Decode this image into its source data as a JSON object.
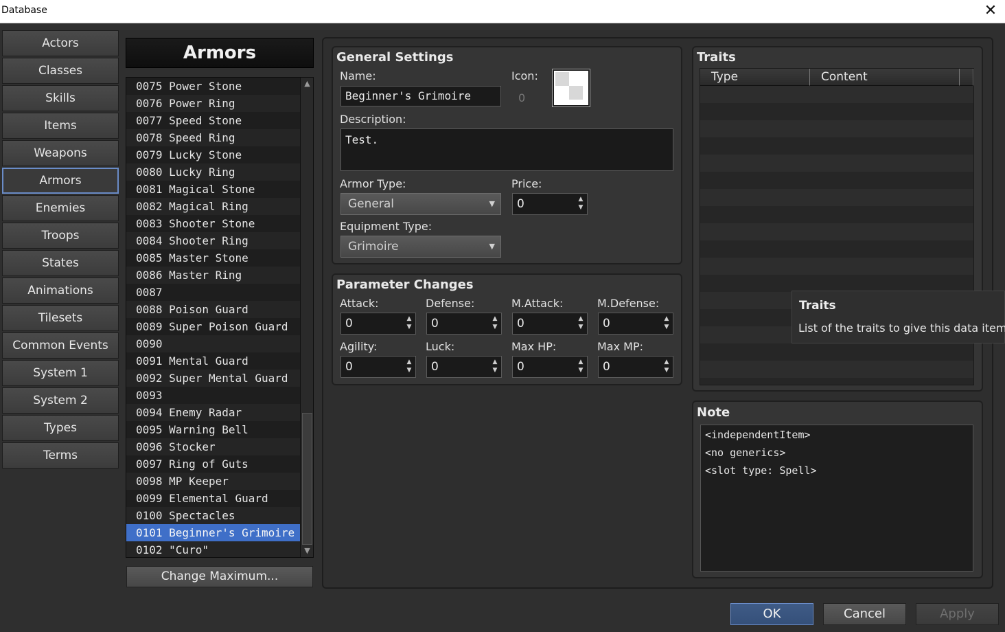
{
  "window": {
    "title": "Database",
    "close_glyph": "✕"
  },
  "nav": [
    "Actors",
    "Classes",
    "Skills",
    "Items",
    "Weapons",
    "Armors",
    "Enemies",
    "Troops",
    "States",
    "Animations",
    "Tilesets",
    "Common Events",
    "System 1",
    "System 2",
    "Types",
    "Terms"
  ],
  "nav_active": "Armors",
  "list": {
    "header": "Armors",
    "items": [
      "0075 Power Stone",
      "0076 Power Ring",
      "0077 Speed Stone",
      "0078 Speed Ring",
      "0079 Lucky Stone",
      "0080 Lucky Ring",
      "0081 Magical Stone",
      "0082 Magical Ring",
      "0083 Shooter Stone",
      "0084 Shooter Ring",
      "0085 Master Stone",
      "0086 Master Ring",
      "0087",
      "0088 Poison Guard",
      "0089 Super Poison Guard",
      "0090",
      "0091 Mental Guard",
      "0092 Super Mental Guard",
      "0093",
      "0094 Enemy Radar",
      "0095 Warning Bell",
      "0096 Stocker",
      "0097 Ring of Guts",
      "0098 MP Keeper",
      "0099 Elemental Guard",
      "0100 Spectacles",
      "0101 Beginner's Grimoire",
      "0102 \"Curo\""
    ],
    "selected": "0101 Beginner's Grimoire",
    "change_max_label": "Change Maximum..."
  },
  "general": {
    "title": "General Settings",
    "name_label": "Name:",
    "name_value": "Beginner's Grimoire",
    "icon_label": "Icon:",
    "icon_index": "0",
    "description_label": "Description:",
    "description_value": "Test.",
    "armor_type_label": "Armor Type:",
    "armor_type_value": "General",
    "price_label": "Price:",
    "price_value": "0",
    "equip_type_label": "Equipment Type:",
    "equip_type_value": "Grimoire"
  },
  "params": {
    "title": "Parameter Changes",
    "fields": [
      {
        "label": "Attack:",
        "value": "0"
      },
      {
        "label": "Defense:",
        "value": "0"
      },
      {
        "label": "M.Attack:",
        "value": "0"
      },
      {
        "label": "M.Defense:",
        "value": "0"
      },
      {
        "label": "Agility:",
        "value": "0"
      },
      {
        "label": "Luck:",
        "value": "0"
      },
      {
        "label": "Max HP:",
        "value": "0"
      },
      {
        "label": "Max MP:",
        "value": "0"
      }
    ]
  },
  "traits": {
    "title": "Traits",
    "col_type": "Type",
    "col_content": "Content",
    "tooltip_title": "Traits",
    "tooltip_body": "List of the traits to give this data item"
  },
  "note": {
    "title": "Note",
    "lines": [
      "<independentItem>",
      "<no generics>",
      "<slot type: Spell>"
    ]
  },
  "footer": {
    "ok": "OK",
    "cancel": "Cancel",
    "apply": "Apply"
  },
  "icons": {
    "spin_up": "▲",
    "spin_down": "▼",
    "combo_caret": "▼",
    "scroll_up": "▲",
    "scroll_down": "▼"
  },
  "colors": {
    "selection": "#3f6fc8",
    "active_border": "#6a8cc8"
  }
}
